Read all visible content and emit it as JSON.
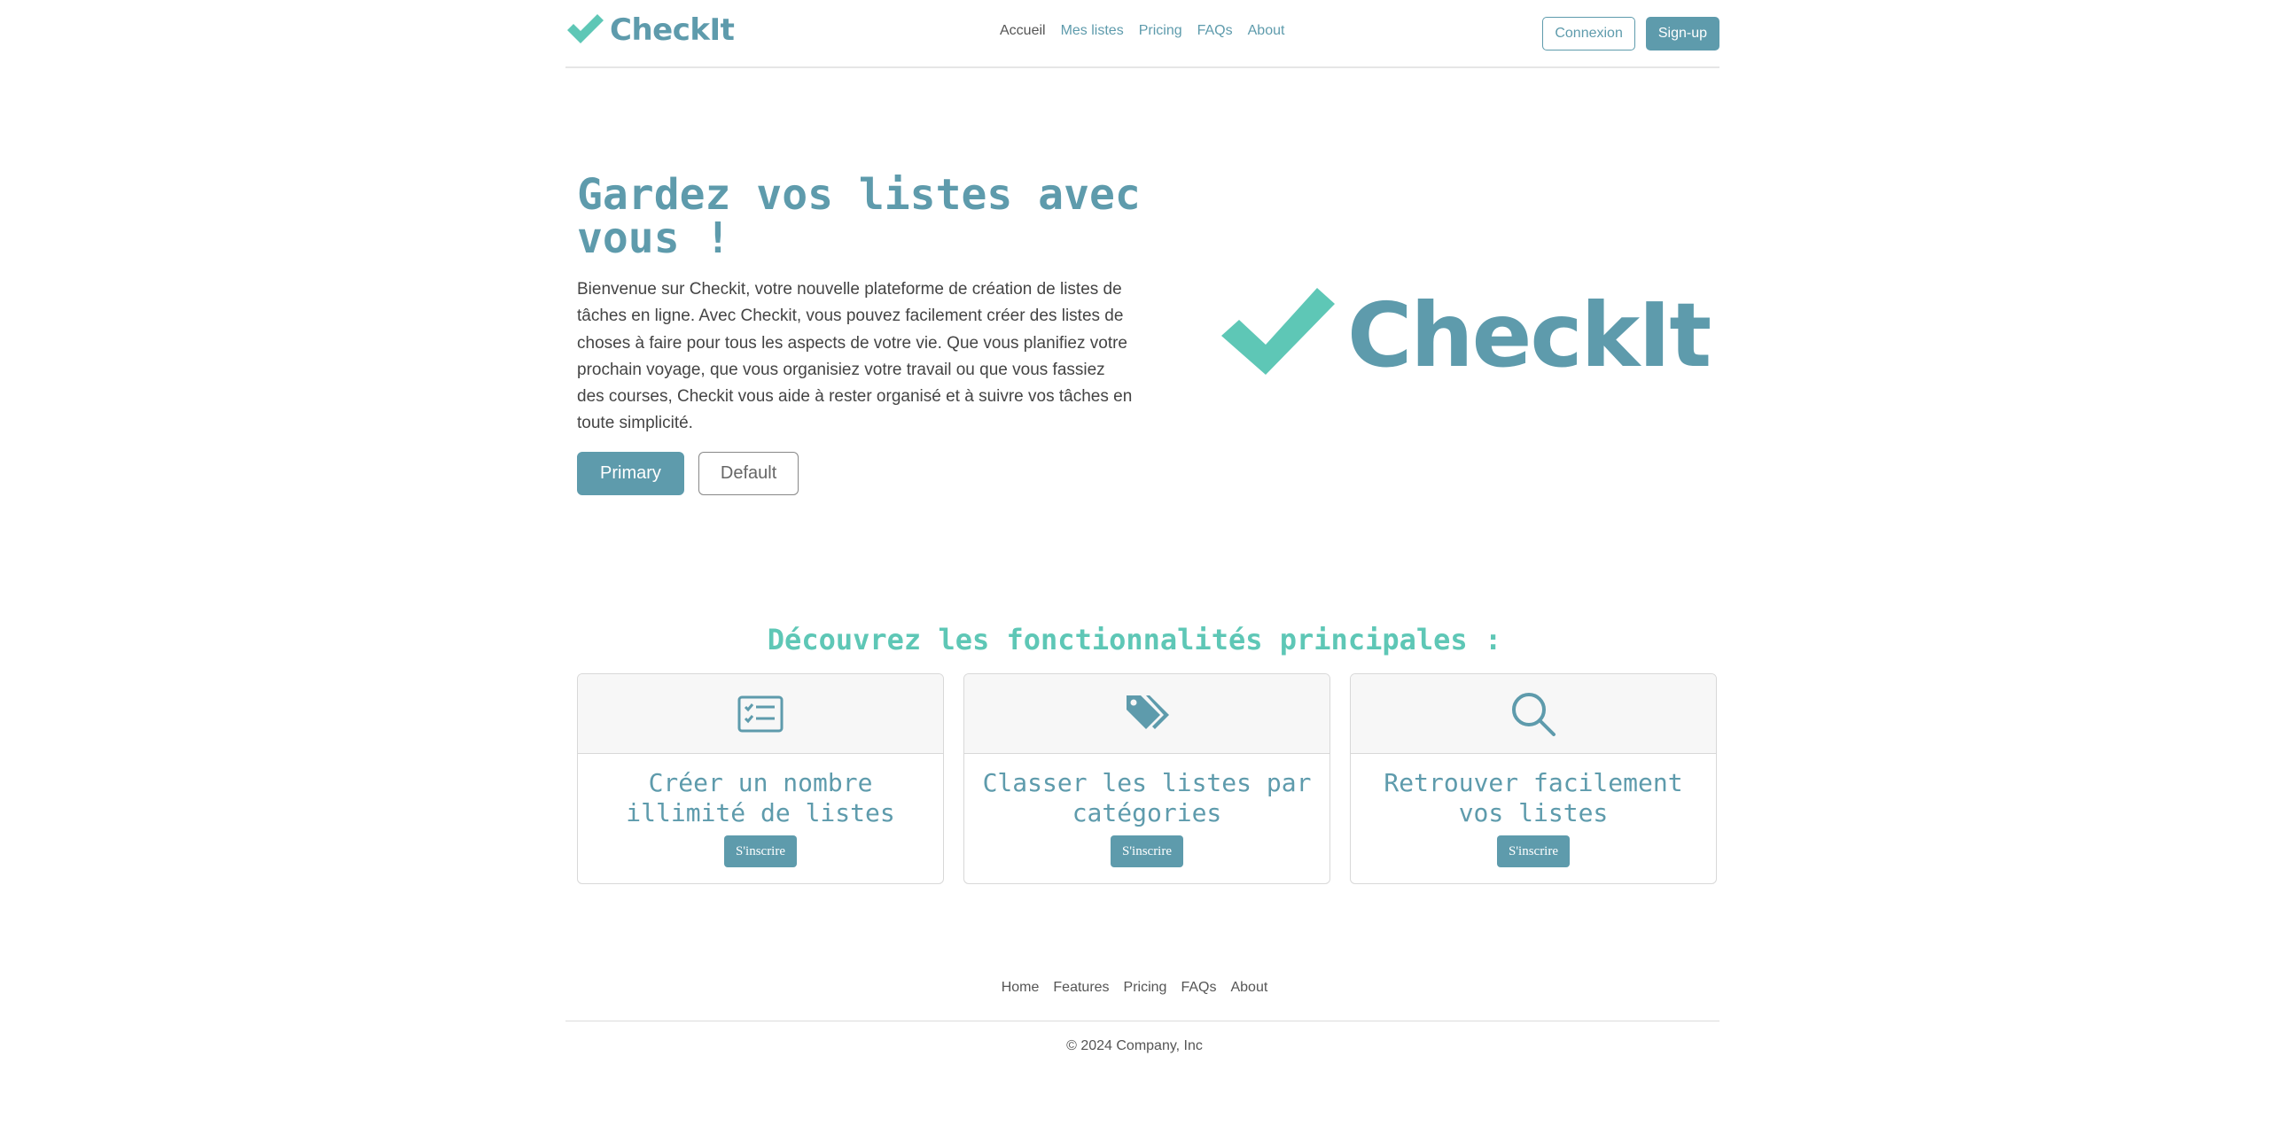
{
  "brand": {
    "name": "CheckIt",
    "check_color": "#5ec7b6",
    "text_color": "#5e9bac"
  },
  "nav": {
    "items": [
      {
        "label": "Accueil",
        "active": true
      },
      {
        "label": "Mes listes",
        "active": false
      },
      {
        "label": "Pricing",
        "active": false
      },
      {
        "label": "FAQs",
        "active": false
      },
      {
        "label": "About",
        "active": false
      }
    ]
  },
  "auth": {
    "login_label": "Connexion",
    "signup_label": "Sign-up"
  },
  "hero": {
    "title": "Gardez vos listes avec vous !",
    "text": "Bienvenue sur Checkit, votre nouvelle plateforme de création de listes de tâches en ligne. Avec Checkit, vous pouvez facilement créer des listes de choses à faire pour tous les aspects de votre vie. Que vous planifiez votre prochain voyage, que vous organisiez votre travail ou que vous fassiez des courses, Checkit vous aide à rester organisé et à suivre vos tâches en toute simplicité.",
    "primary_label": "Primary",
    "default_label": "Default",
    "logo_text": "CheckIt"
  },
  "features": {
    "title": "Découvrez les fonctionnalités principales :",
    "cards": [
      {
        "icon": "checklist-icon",
        "title": "Créer un nombre illimité de listes",
        "button": "S'inscrire"
      },
      {
        "icon": "tags-icon",
        "title": "Classer les listes par catégories",
        "button": "S'inscrire"
      },
      {
        "icon": "search-icon",
        "title": "Retrouver facilement vos listes",
        "button": "S'inscrire"
      }
    ]
  },
  "footer": {
    "links": [
      "Home",
      "Features",
      "Pricing",
      "FAQs",
      "About"
    ],
    "copyright": "© 2024 Company, Inc"
  },
  "colors": {
    "primary": "#5e9bac",
    "accent": "#5ec7b6"
  }
}
